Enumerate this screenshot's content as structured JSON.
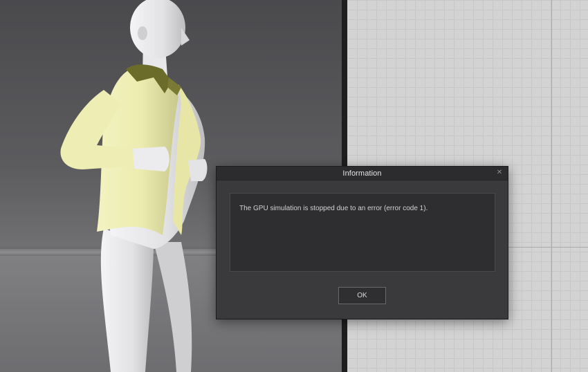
{
  "dialog": {
    "title": "Information",
    "close_icon": "close-icon",
    "message": "The GPU simulation is stopped due to an error (error code 1).",
    "ok_label": "OK"
  },
  "colors": {
    "dialog_bg": "#3a3a3c",
    "titlebar_bg": "#2c2c2e",
    "shirt": "#f0f0b4",
    "collar": "#6b6b2a",
    "avatar": "#e6e6e8",
    "grid_bg": "#d3d3d3"
  }
}
